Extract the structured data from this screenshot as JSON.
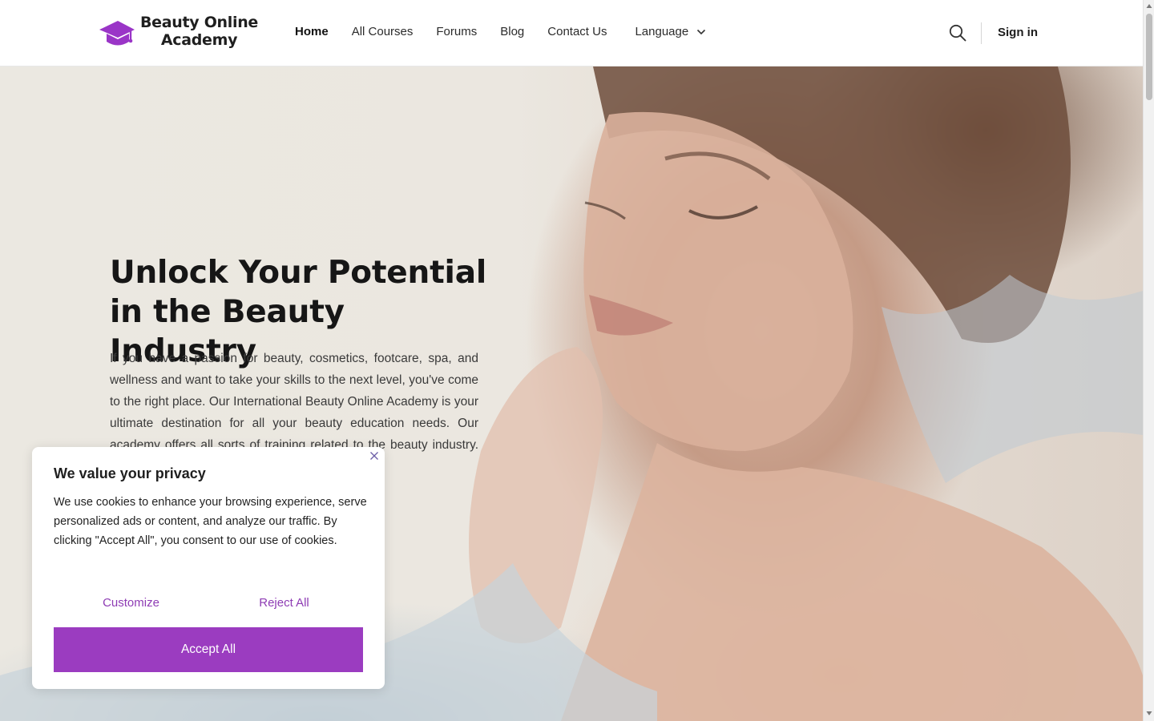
{
  "header": {
    "logo": {
      "line1": "Beauty Online",
      "line2": "Academy",
      "icon": "graduation-cap-icon"
    },
    "nav": [
      {
        "label": "Home",
        "active": true
      },
      {
        "label": "All Courses",
        "active": false
      },
      {
        "label": "Forums",
        "active": false
      },
      {
        "label": "Blog",
        "active": false
      },
      {
        "label": "Contact Us",
        "active": false
      }
    ],
    "language": {
      "label": "Language",
      "icon": "chevron-down-icon"
    },
    "search_icon": "search-icon",
    "signin_label": "Sign in"
  },
  "hero": {
    "title_line1": "Unlock Your Potential",
    "title_line2": "in the Beauty Industry",
    "text": "If you have a passion for beauty, cosmetics, footcare, spa, and wellness and want to take your skills to the next level, you've come to the right place. Our International Beauty Online Academy is your ultimate destination for all your beauty education needs. Our academy offers all sorts of training related to the beauty industry. So, welcome join us and"
  },
  "cookie_banner": {
    "title": "We value your privacy",
    "text": "We use cookies to enhance your browsing experience, serve personalized ads or content, and analyze our traffic. By clicking \"Accept All\", you consent to our use of cookies.",
    "customize_label": "Customize",
    "reject_label": "Reject All",
    "accept_label": "Accept All",
    "close_icon": "close-icon"
  },
  "colors": {
    "accent": "#9b3cc0",
    "accent_text": "#8e3cb4",
    "logo_purple": "#9a35c7"
  }
}
